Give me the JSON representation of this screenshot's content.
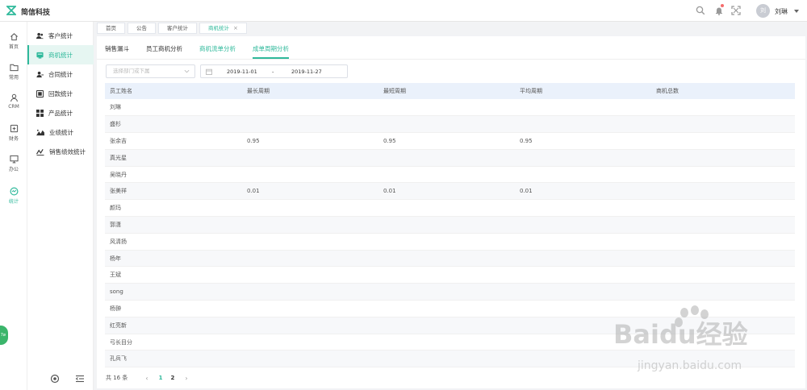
{
  "header": {
    "brand": "简信科技",
    "user_initial": "刘",
    "user_name": "刘琳"
  },
  "rail": [
    {
      "label": "首页",
      "icon": "home-icon"
    },
    {
      "label": "常用",
      "icon": "folder-icon"
    },
    {
      "label": "CRM",
      "icon": "crm-user-icon"
    },
    {
      "label": "财务",
      "icon": "finance-icon"
    },
    {
      "label": "办公",
      "icon": "monitor-icon"
    },
    {
      "label": "统计",
      "icon": "statistics-icon",
      "active": true
    }
  ],
  "sidebar": {
    "items": [
      {
        "label": "客户统计",
        "icon": "customers-icon"
      },
      {
        "label": "商机统计",
        "icon": "opportunity-icon",
        "active": true
      },
      {
        "label": "合同统计",
        "icon": "contract-icon"
      },
      {
        "label": "回款统计",
        "icon": "payment-icon"
      },
      {
        "label": "产品统计",
        "icon": "product-icon"
      },
      {
        "label": "业绩统计",
        "icon": "performance-icon"
      },
      {
        "label": "销售绩效统计",
        "icon": "sales-kpi-icon"
      }
    ]
  },
  "floatball": {
    "label": "7ø"
  },
  "tabs": [
    {
      "label": "首页"
    },
    {
      "label": "公告"
    },
    {
      "label": "客户统计"
    },
    {
      "label": "商机统计",
      "active": true,
      "closable": true
    }
  ],
  "subtabs": [
    {
      "label": "销售漏斗"
    },
    {
      "label": "员工商机分析"
    },
    {
      "label": "商机流单分析"
    },
    {
      "label": "成单周期分析",
      "active": true
    }
  ],
  "filters": {
    "dept_placeholder": "选择部门或下属",
    "date_start": "2019-11-01",
    "date_sep": "-",
    "date_end": "2019-11-27"
  },
  "table": {
    "columns": [
      "员工姓名",
      "最长周期",
      "最短周期",
      "平均周期",
      "商机总数"
    ],
    "rows": [
      [
        "刘琳",
        "",
        "",
        "",
        ""
      ],
      [
        "盛杉",
        "",
        "",
        "",
        ""
      ],
      [
        "张余吉",
        "0.95",
        "0.95",
        "0.95",
        ""
      ],
      [
        "真光星",
        "",
        "",
        "",
        ""
      ],
      [
        "吴晓丹",
        "",
        "",
        "",
        ""
      ],
      [
        "张美祥",
        "0.01",
        "0.01",
        "0.01",
        ""
      ],
      [
        "颜玛",
        "",
        "",
        "",
        ""
      ],
      [
        "郭潇",
        "",
        "",
        "",
        ""
      ],
      [
        "风清扬",
        "",
        "",
        "",
        ""
      ],
      [
        "杨年",
        "",
        "",
        "",
        ""
      ],
      [
        "王斌",
        "",
        "",
        "",
        ""
      ],
      [
        "song",
        "",
        "",
        "",
        ""
      ],
      [
        "杨翀",
        "",
        "",
        "",
        ""
      ],
      [
        "红亮新",
        "",
        "",
        "",
        ""
      ],
      [
        "弓长目分",
        "",
        "",
        "",
        ""
      ],
      [
        "孔兵飞",
        "",
        "",
        "",
        ""
      ]
    ]
  },
  "pagination": {
    "total": "共 16 条",
    "pages": [
      "1",
      "2"
    ],
    "current": "1"
  },
  "watermark": {
    "text": "Baidu经验",
    "url": "jingyan.baidu.com"
  },
  "colors": {
    "accent": "#2fb99b",
    "header_row": "#eaf1fb"
  }
}
